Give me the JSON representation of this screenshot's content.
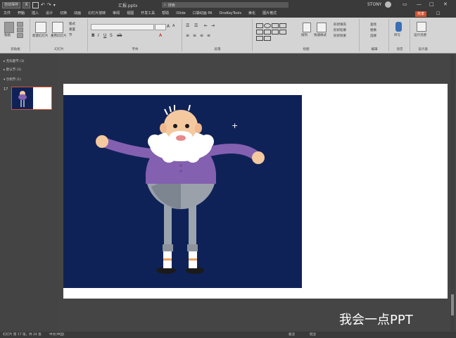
{
  "titlebar": {
    "autosave_label": "自动保存",
    "autosave_state": "关",
    "doc_name": "汇报.pptx",
    "search_placeholder": "搜索",
    "user": "STONY"
  },
  "tabs": [
    "文件",
    "开始",
    "插入",
    "设计",
    "切换",
    "动画",
    "幻灯片放映",
    "审阅",
    "视图",
    "开发工具",
    "帮助",
    "iSlide",
    "口袋动画 PA",
    "OneKeyTools",
    "美化",
    "图片格式"
  ],
  "active_tab_index": 1,
  "share_label": "共享",
  "ribbon": {
    "groups": [
      "剪贴板",
      "幻灯片",
      "字体",
      "段落",
      "绘图",
      "编辑",
      "语音",
      "设计器"
    ],
    "clipboard": {
      "paste": "粘贴"
    },
    "slides": {
      "new_slide": "新建幻灯片",
      "reuse": "重用幻灯片",
      "layout": "版式",
      "reset": "重置",
      "section": "节"
    },
    "drawing": {
      "arrange": "排列",
      "quick_styles": "快速样式",
      "fill": "形状填充",
      "outline": "形状轮廓",
      "effects": "形状效果"
    },
    "editing": {
      "find": "查找",
      "replace": "替换",
      "select": "选择"
    },
    "voice": {
      "dictate": "听写"
    },
    "designer": {
      "ideas": "设计灵感"
    }
  },
  "sidepane": {
    "sections": [
      "无标题节 (3)",
      "默认节 (3)",
      "示例节 (1)"
    ],
    "slide_number": "17"
  },
  "statusbar": {
    "slide_info": "幻灯片 第 17 张，共 24 张",
    "language": "中文(中国)",
    "notes": "备注",
    "comments": "批注"
  },
  "watermark": "我会一点PPT"
}
